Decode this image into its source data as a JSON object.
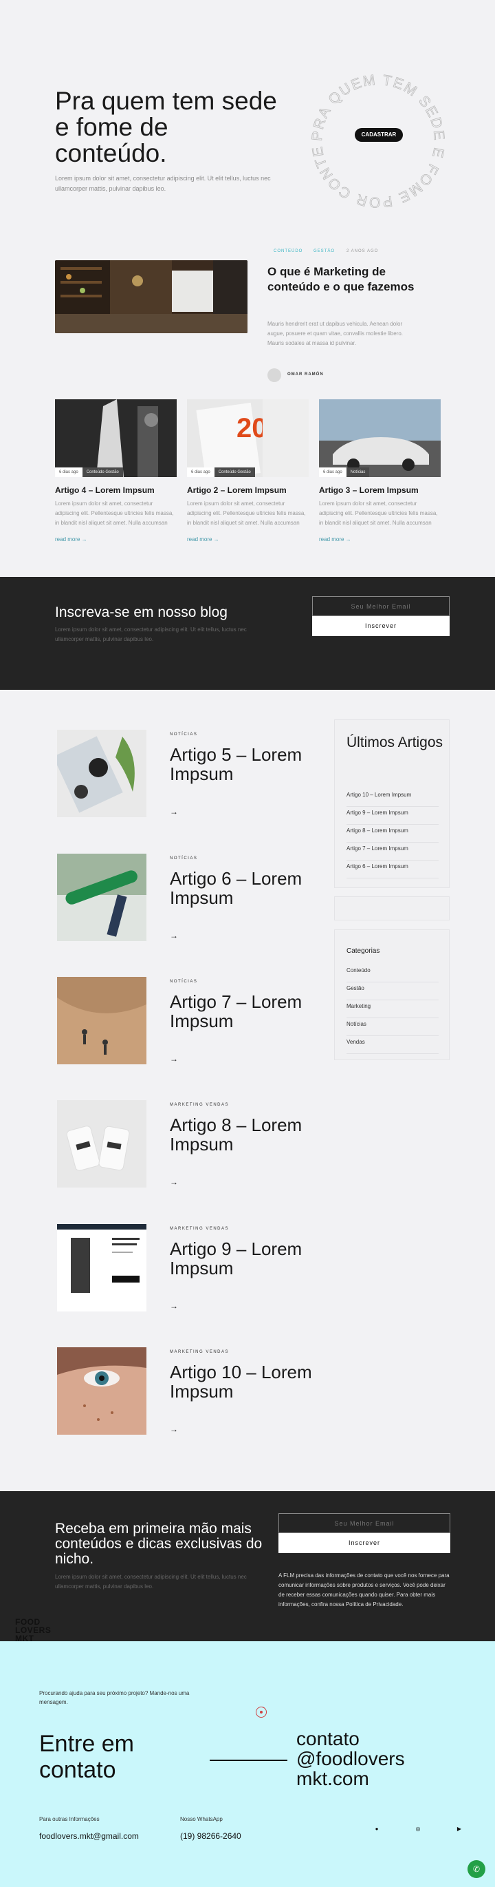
{
  "hero": {
    "title": "Pra quem tem sede e fome de conteúdo.",
    "subtitle": "Lorem ipsum dolor sit amet, consectetur adipiscing elit. Ut elit tellus, luctus nec ullamcorper mattis, pulvinar dapibus leo.",
    "cta": "CADASTRAR",
    "ring_text": "PRA QUEM TEM SEDE E FOME POR CONTEÚDO"
  },
  "featured": {
    "tag1": "CONTEÚDO",
    "tag2": "GESTÃO",
    "date": "2 ANOS AGO",
    "title": "O que é Marketing de conteúdo e o que fazemos",
    "text": "Mauris hendrerit erat ut dapibus vehicula. Aenean dolor augue, posuere et quam vitae, convallis molestie libero. Mauris sodales at massa id pulvinar.",
    "author": "OMAR RAMÓN"
  },
  "cards": [
    {
      "ago": "6 dias ago",
      "tag": "Conteúdo  Gestão",
      "title": "Artigo 4 – Lorem Impsum",
      "text": "Lorem ipsum dolor sit amet, consectetur adipiscing elit. Pellentesque ultricies felis massa, in blandit nisl aliquet sit amet. Nulla accumsan",
      "link": "read more →"
    },
    {
      "ago": "6 dias ago",
      "tag": "Conteúdo  Gestão",
      "title": "Artigo 2 – Lorem Impsum",
      "text": "Lorem ipsum dolor sit amet, consectetur adipiscing elit. Pellentesque ultricies felis massa, in blandit nisl aliquet sit amet. Nulla accumsan",
      "link": "read more →"
    },
    {
      "ago": "6 dias ago",
      "tag": "Notícias",
      "title": "Artigo 3 – Lorem Impsum",
      "text": "Lorem ipsum dolor sit amet, consectetur adipiscing elit. Pellentesque ultricies felis massa, in blandit nisl aliquet sit amet. Nulla accumsan",
      "link": "read more →"
    }
  ],
  "newsletter1": {
    "title": "Inscreva-se em nosso blog",
    "text": "Lorem ipsum dolor sit amet, consectetur adipiscing elit. Ut elit tellus, luctus nec ullamcorper mattis, pulvinar dapibus leo.",
    "placeholder": "Seu Melhor Email",
    "button": "Inscrever"
  },
  "articles": [
    {
      "cat": "NOTÍCIAS",
      "title": "Artigo 5 – Lorem Impsum"
    },
    {
      "cat": "NOTÍCIAS",
      "title": "Artigo 6 – Lorem Impsum"
    },
    {
      "cat": "NOTÍCIAS",
      "title": "Artigo 7 – Lorem Impsum"
    },
    {
      "cat": "MARKETING VENDAS",
      "title": "Artigo 8 – Lorem Impsum"
    },
    {
      "cat": "MARKETING VENDAS",
      "title": "Artigo 9 – Lorem Impsum"
    },
    {
      "cat": "MARKETING VENDAS",
      "title": "Artigo 10 – Lorem Impsum"
    }
  ],
  "sidebar": {
    "latest_title": "Últimos Artigos",
    "latest": [
      "Artigo 10 – Lorem Impsum",
      "Artigo 9 – Lorem Impsum",
      "Artigo 8 – Lorem Impsum",
      "Artigo 7 – Lorem Impsum",
      "Artigo 6 – Lorem Impsum"
    ],
    "categories_title": "Categorias",
    "categories": [
      "Conteúdo",
      "Gestão",
      "Marketing",
      "Notícias",
      "Vendas"
    ]
  },
  "newsletter2": {
    "title": "Receba em primeira mão mais conteúdos e dicas exclusivas do nicho.",
    "text": "Lorem ipsum dolor sit amet, consectetur adipiscing elit. Ut elit tellus, luctus nec ullamcorper mattis, pulvinar dapibus leo.",
    "placeholder": "Seu Melhor Email",
    "button": "Inscrever",
    "legal": "A FLM precisa das informações de contato que você nos fornece para comunicar informações sobre produtos e serviços. Você pode deixar de receber essas comunicações quando quiser. Para obter mais informações, confira nossa Política de Privacidade."
  },
  "logo": {
    "l1": "FOOD",
    "l2": "LOVERS",
    "l3": "MKT"
  },
  "contact": {
    "help": "Procurando ajuda para seu próximo projeto? Mande-nos uma mensagem.",
    "title": "Entre em contato",
    "email_big": "contato @foodlovers mkt.com",
    "label_email": "Para outras Informações",
    "email": "foodlovers.mkt@gmail.com",
    "label_whats": "Nosso WhatsApp",
    "whats": "(19) 98266-2640"
  }
}
